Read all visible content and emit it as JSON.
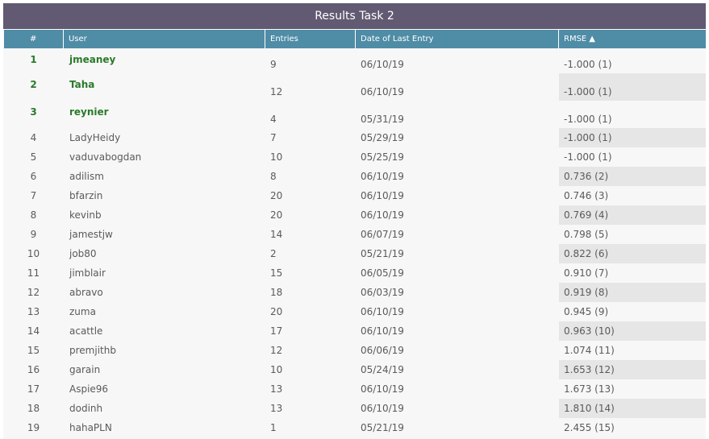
{
  "title": "Results Task 2",
  "columns": {
    "rank": "#",
    "user": "User",
    "entries": "Entries",
    "date": "Date of Last Entry",
    "rmse": "RMSE",
    "sort_icon": "triangle-up-icon"
  },
  "rows": [
    {
      "rank": "1",
      "user": "jmeaney",
      "entries": "9",
      "date": "06/10/19",
      "rmse": "-1.000 (1)"
    },
    {
      "rank": "2",
      "user": "Taha",
      "entries": "12",
      "date": "06/10/19",
      "rmse": "-1.000 (1)"
    },
    {
      "rank": "3",
      "user": "reynier",
      "entries": "4",
      "date": "05/31/19",
      "rmse": "-1.000 (1)"
    },
    {
      "rank": "4",
      "user": "LadyHeidy",
      "entries": "7",
      "date": "05/29/19",
      "rmse": "-1.000 (1)"
    },
    {
      "rank": "5",
      "user": "vaduvabogdan",
      "entries": "10",
      "date": "05/25/19",
      "rmse": "-1.000 (1)"
    },
    {
      "rank": "6",
      "user": "adilism",
      "entries": "8",
      "date": "06/10/19",
      "rmse": "0.736 (2)"
    },
    {
      "rank": "7",
      "user": "bfarzin",
      "entries": "20",
      "date": "06/10/19",
      "rmse": "0.746 (3)"
    },
    {
      "rank": "8",
      "user": "kevinb",
      "entries": "20",
      "date": "06/10/19",
      "rmse": "0.769 (4)"
    },
    {
      "rank": "9",
      "user": "jamestjw",
      "entries": "14",
      "date": "06/07/19",
      "rmse": "0.798 (5)"
    },
    {
      "rank": "10",
      "user": "job80",
      "entries": "2",
      "date": "05/21/19",
      "rmse": "0.822 (6)"
    },
    {
      "rank": "11",
      "user": "jimblair",
      "entries": "15",
      "date": "06/05/19",
      "rmse": "0.910 (7)"
    },
    {
      "rank": "12",
      "user": "abravo",
      "entries": "18",
      "date": "06/03/19",
      "rmse": "0.919 (8)"
    },
    {
      "rank": "13",
      "user": "zuma",
      "entries": "20",
      "date": "06/10/19",
      "rmse": "0.945 (9)"
    },
    {
      "rank": "14",
      "user": "acattle",
      "entries": "17",
      "date": "06/10/19",
      "rmse": "0.963 (10)"
    },
    {
      "rank": "15",
      "user": "premjithb",
      "entries": "12",
      "date": "06/06/19",
      "rmse": "1.074 (11)"
    },
    {
      "rank": "16",
      "user": "garain",
      "entries": "10",
      "date": "05/24/19",
      "rmse": "1.653 (12)"
    },
    {
      "rank": "17",
      "user": "Aspie96",
      "entries": "13",
      "date": "06/10/19",
      "rmse": "1.673 (13)"
    },
    {
      "rank": "18",
      "user": "dodinh",
      "entries": "13",
      "date": "06/10/19",
      "rmse": "1.810 (14)"
    },
    {
      "rank": "19",
      "user": "hahaPLN",
      "entries": "1",
      "date": "05/21/19",
      "rmse": "2.455 (15)"
    }
  ]
}
